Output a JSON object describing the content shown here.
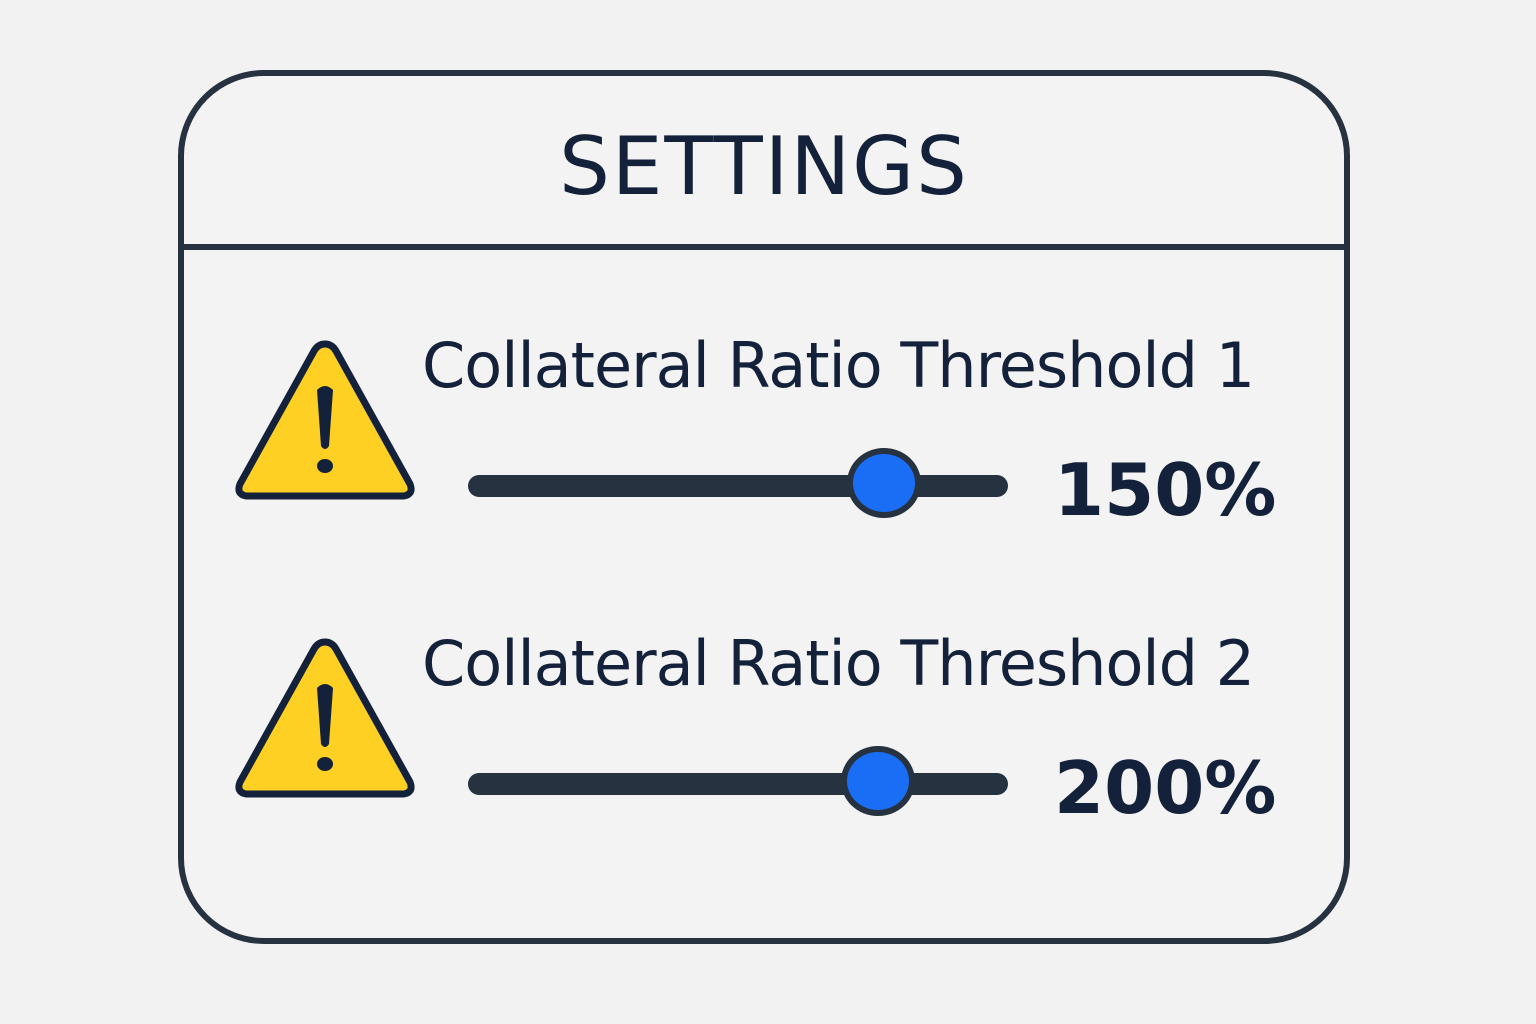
{
  "title": "SETTINGS",
  "settings": [
    {
      "label": "Collateral Ratio Threshold 1",
      "value": "150%",
      "slider_level": 0.77,
      "icon": "warning-icon"
    },
    {
      "label": "Collateral Ratio Threshold 2",
      "value": "200%",
      "slider_level": 0.76,
      "icon": "warning-icon"
    }
  ],
  "colors": {
    "background": "#f2f2f2",
    "border": "#263240",
    "text": "#14213a",
    "warning_fill": "#fdd023",
    "slider_thumb": "#1a6ef5"
  }
}
